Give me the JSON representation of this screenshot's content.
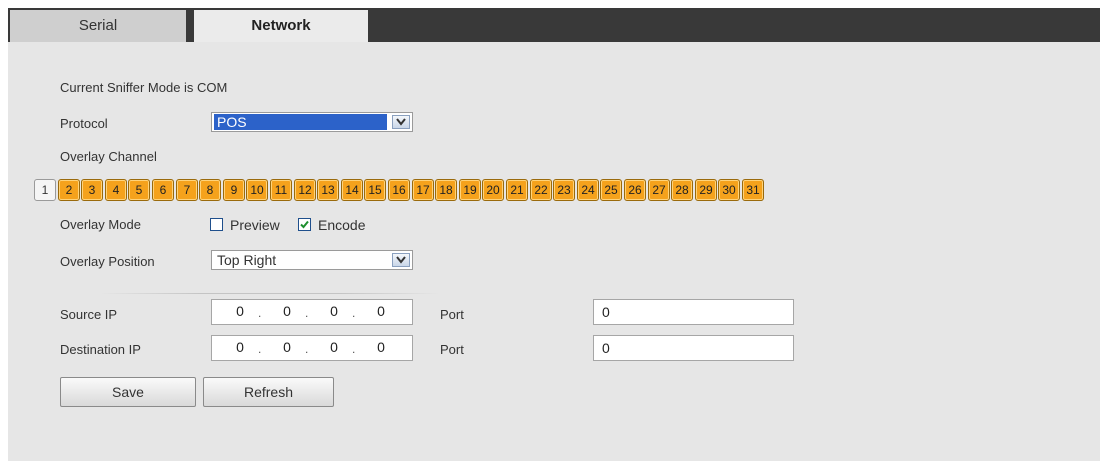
{
  "tabs": [
    {
      "label": "Serial",
      "active": false
    },
    {
      "label": "Network",
      "active": true
    }
  ],
  "sniffer_mode_text": "Current Sniffer Mode is COM",
  "protocol": {
    "label": "Protocol",
    "value": "POS"
  },
  "overlay_channel": {
    "label": "Overlay Channel",
    "channels": [
      "1",
      "2",
      "3",
      "4",
      "5",
      "6",
      "7",
      "8",
      "9",
      "10",
      "11",
      "12",
      "13",
      "14",
      "15",
      "16",
      "17",
      "18",
      "19",
      "20",
      "21",
      "22",
      "23",
      "24",
      "25",
      "26",
      "27",
      "28",
      "29",
      "30",
      "31"
    ],
    "selected": [
      "2",
      "3",
      "4",
      "5",
      "6",
      "7",
      "8",
      "9",
      "10",
      "11",
      "12",
      "13",
      "14",
      "15",
      "16",
      "17",
      "18",
      "19",
      "20",
      "21",
      "22",
      "23",
      "24",
      "25",
      "26",
      "27",
      "28",
      "29",
      "30",
      "31"
    ]
  },
  "overlay_mode": {
    "label": "Overlay Mode",
    "preview": {
      "label": "Preview",
      "checked": false
    },
    "encode": {
      "label": "Encode",
      "checked": true
    }
  },
  "overlay_position": {
    "label": "Overlay Position",
    "value": "Top Right"
  },
  "source": {
    "label": "Source IP",
    "ip": [
      "0",
      "0",
      "0",
      "0"
    ],
    "port_label": "Port",
    "port": "0"
  },
  "destination": {
    "label": "Destination IP",
    "ip": [
      "0",
      "0",
      "0",
      "0"
    ],
    "port_label": "Port",
    "port": "0"
  },
  "buttons": {
    "save": "Save",
    "refresh": "Refresh"
  },
  "colors": {
    "channel_on": "#f5a21c",
    "channel_off": "#f5f5f5",
    "tabbar": "#393939",
    "select_highlight": "#2c62c9"
  }
}
